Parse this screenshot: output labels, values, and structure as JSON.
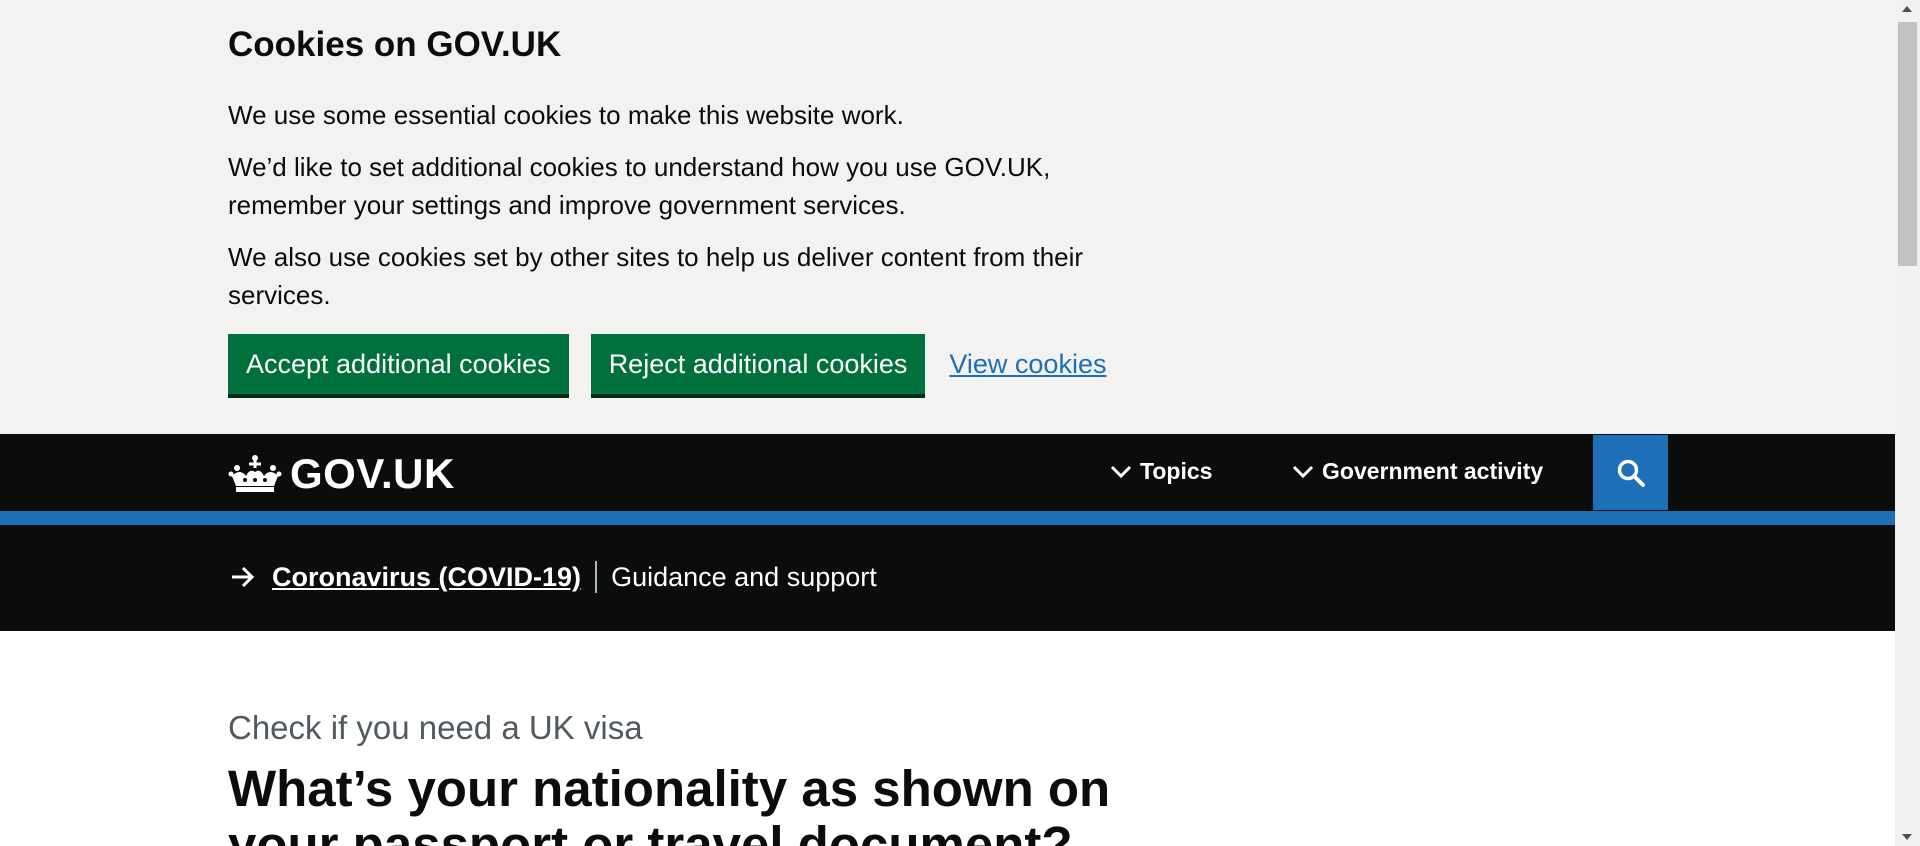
{
  "cookie_banner": {
    "title": "Cookies on GOV.UK",
    "paragraphs": [
      "We use some essential cookies to make this website work.",
      "We’d like to set additional cookies to understand how you use GOV.UK, remember your settings and improve government services.",
      "We also use cookies set by other sites to help us deliver content from their services."
    ],
    "accept_label": "Accept additional cookies",
    "reject_label": "Reject additional cookies",
    "view_label": "View cookies"
  },
  "header": {
    "logo_text": "GOV.UK",
    "nav": [
      {
        "label": "Topics",
        "icon": "chevron-down-icon"
      },
      {
        "label": "Government activity",
        "icon": "chevron-down-icon"
      }
    ],
    "search_icon": "search-icon"
  },
  "covid": {
    "link_label": "Coronavirus (COVID-19)",
    "text": "Guidance and support"
  },
  "main": {
    "caption": "Check if you need a UK visa",
    "question": "What’s your nationality as shown on your passport or travel document?"
  },
  "colors": {
    "banner_bg": "#f3f2f1",
    "green": "#00703c",
    "link_blue": "#1d70b8",
    "header_bg": "#0b0c0c",
    "accent_blue": "#1d70b8"
  }
}
